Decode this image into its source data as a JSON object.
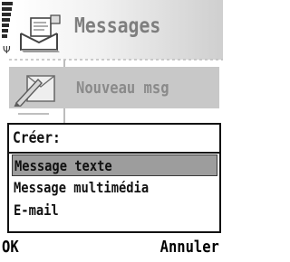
{
  "title": {
    "text": "Messages",
    "icon": "messages-envelope-icon"
  },
  "status": {
    "signal_icon": "signal-strength-icon",
    "antenna_icon": "antenna-icon",
    "antenna_glyph": "Ψ"
  },
  "list": {
    "item_label": "Nouveau msg",
    "item_icon": "new-message-icon"
  },
  "popup": {
    "heading": "Créer:",
    "options": [
      {
        "label": "Message texte",
        "selected": true
      },
      {
        "label": "Message multimédia",
        "selected": false
      },
      {
        "label": "E-mail",
        "selected": false
      }
    ]
  },
  "softkeys": {
    "left": "OK",
    "right": "Annuler"
  },
  "colors": {
    "selection": "#9d9d9d",
    "dim_text": "#8a8a8a",
    "border": "#111111"
  }
}
